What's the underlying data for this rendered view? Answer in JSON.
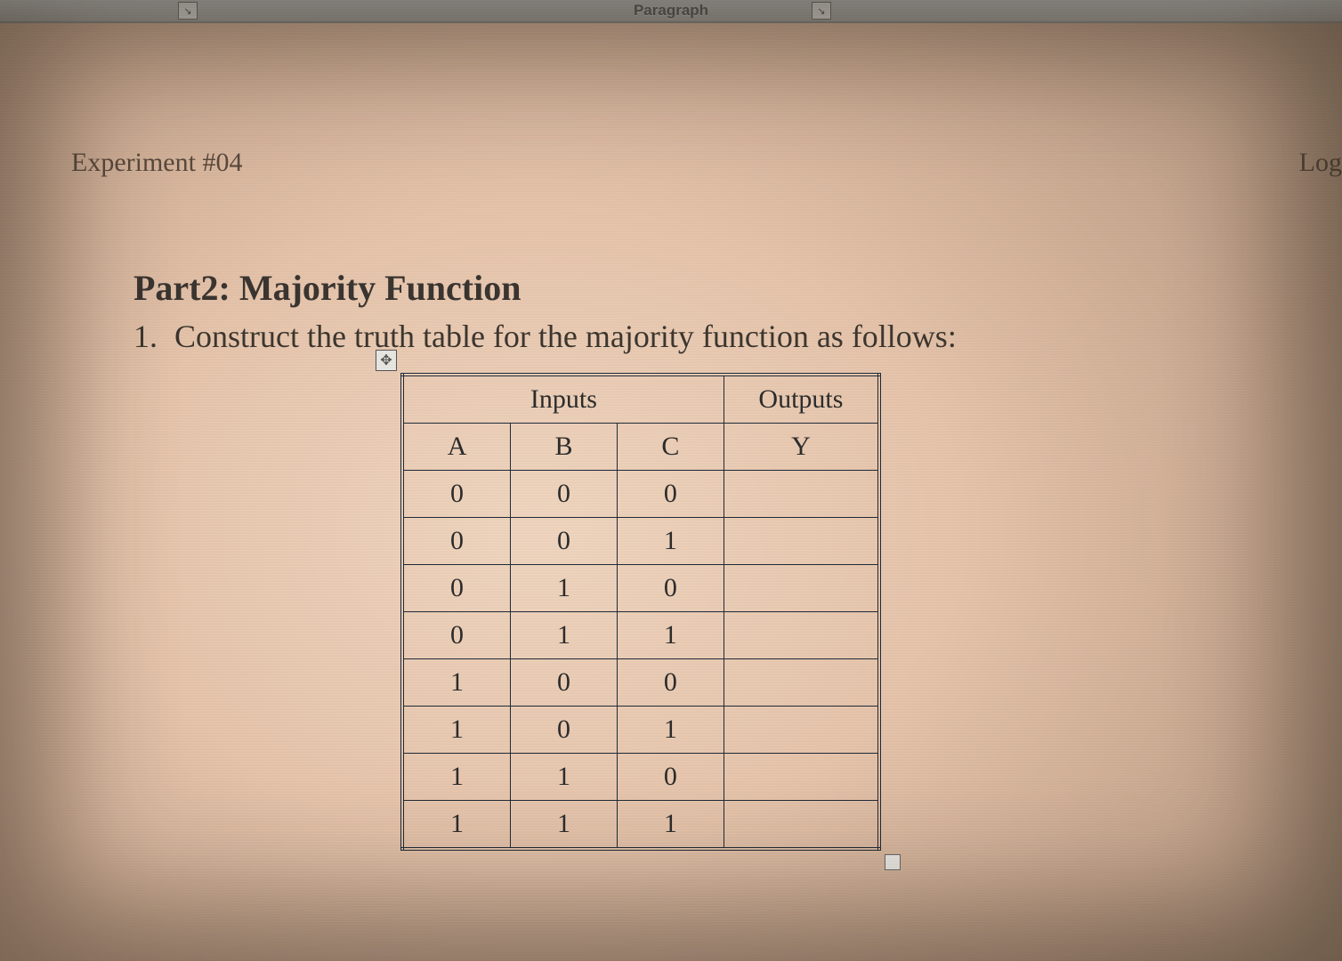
{
  "toolbar": {
    "group_label": "Paragraph",
    "left_btn_glyph": "↘",
    "right_btn_glyph": "↘"
  },
  "header": {
    "left": "Experiment #04",
    "right": "Log"
  },
  "section": {
    "title": "Part2: Majority Function",
    "item_number": "1.",
    "item_text": "Construct the truth table for the majority function as follows:"
  },
  "table": {
    "move_glyph": "✥",
    "group_headers": {
      "inputs": "Inputs",
      "outputs": "Outputs"
    },
    "col_headers": {
      "a": "A",
      "b": "B",
      "c": "C",
      "y": "Y"
    },
    "rows": [
      {
        "a": "0",
        "b": "0",
        "c": "0",
        "y": ""
      },
      {
        "a": "0",
        "b": "0",
        "c": "1",
        "y": ""
      },
      {
        "a": "0",
        "b": "1",
        "c": "0",
        "y": ""
      },
      {
        "a": "0",
        "b": "1",
        "c": "1",
        "y": ""
      },
      {
        "a": "1",
        "b": "0",
        "c": "0",
        "y": ""
      },
      {
        "a": "1",
        "b": "0",
        "c": "1",
        "y": ""
      },
      {
        "a": "1",
        "b": "1",
        "c": "0",
        "y": ""
      },
      {
        "a": "1",
        "b": "1",
        "c": "1",
        "y": ""
      }
    ]
  }
}
